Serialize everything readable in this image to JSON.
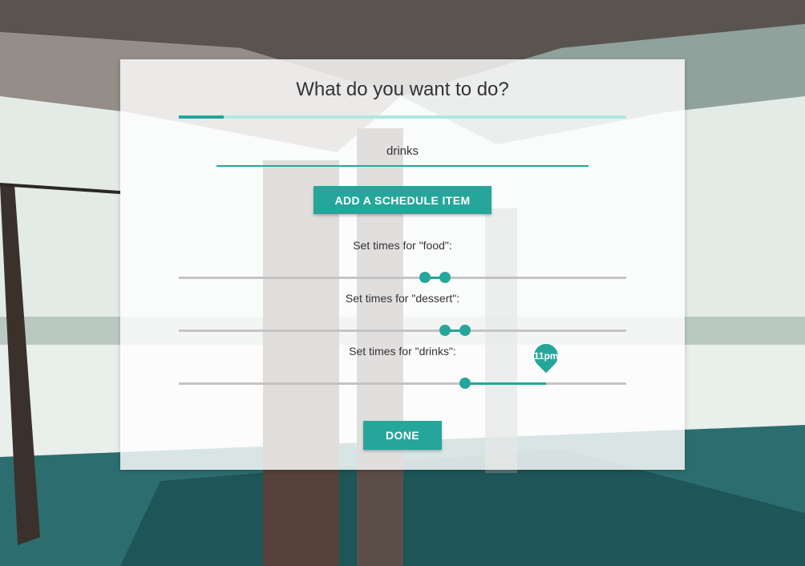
{
  "prompt": {
    "title": "What do you want to do?",
    "progress_fraction": 0.1
  },
  "activity_input": {
    "value": "drinks",
    "placeholder": ""
  },
  "buttons": {
    "add_label": "Add a schedule item",
    "done_label": "Done"
  },
  "sliders": [
    {
      "label": "Set times for \"food\":",
      "range": [
        0.55,
        0.595
      ],
      "bubble": ""
    },
    {
      "label": "Set times for \"dessert\":",
      "range": [
        0.595,
        0.64
      ],
      "bubble": ""
    },
    {
      "label": "Set times for \"drinks\":",
      "range": [
        0.64,
        0.82
      ],
      "bubble": "11pm"
    }
  ],
  "colors": {
    "accent": "#26a69a",
    "track": "#c4c4c4",
    "progress_bg": "#aee7e3"
  }
}
